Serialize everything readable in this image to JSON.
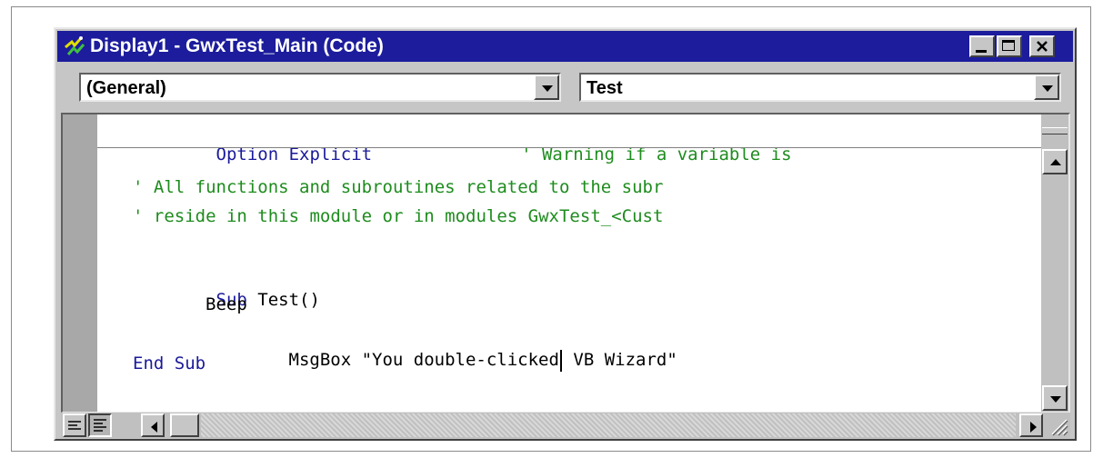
{
  "window": {
    "title": "Display1 - GwxTest_Main (Code)",
    "icons": [
      "app-icon",
      "minimize-icon",
      "maximize-icon",
      "close-icon"
    ]
  },
  "combos": {
    "object_value": "(General)",
    "procedure_value": "Test"
  },
  "code": {
    "line1_kw": "Option Explicit",
    "line1_comment": "' Warning if a variable is",
    "line2": "' All functions and subroutines related to the subr",
    "line3": "' reside in this module or in modules GwxTest_<Cust",
    "line4_kw": "Sub",
    "line4_rest": " Test()",
    "line5": "Beep",
    "line6_a": "MsgBox \"You double-clicked",
    "line6_b": " VB Wizard\"",
    "line7": "End Sub"
  },
  "colors": {
    "titlebar": "#1c1c9c",
    "keyword": "#1a1a9a",
    "comment": "#1e8c1e",
    "chrome": "#c6c6c6"
  }
}
